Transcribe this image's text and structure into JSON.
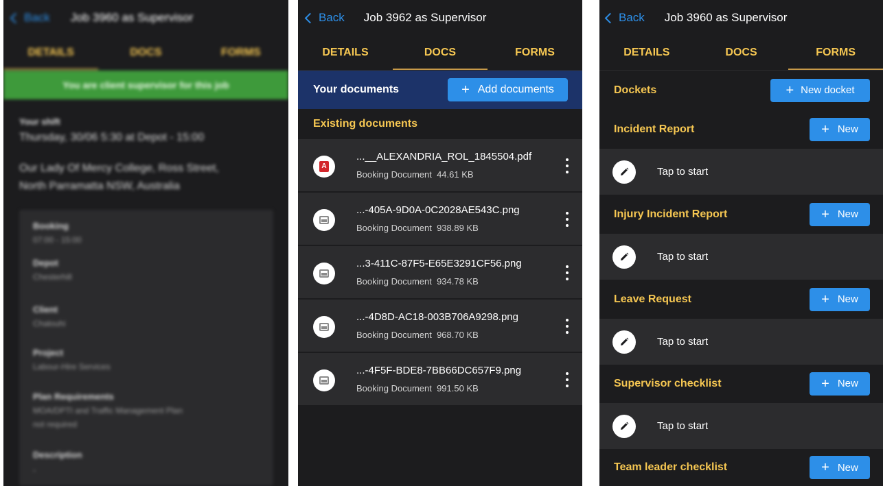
{
  "colors": {
    "accent": "#2d8fe8",
    "tab_text": "#f6c752",
    "banner_green": "#3e9a3b",
    "docs_header": "#1c3369",
    "background": "#1c1c1e",
    "row": "#2c2c2e"
  },
  "panel1": {
    "back_label": "Back",
    "title": "Job 3960 as Supervisor",
    "tabs": [
      "DETAILS",
      "DOCS",
      "FORMS"
    ],
    "active_tab": "DETAILS",
    "banner": "You are client supervisor for this job",
    "shift_label": "Your shift",
    "shift_value": "Thursday, 30/06 5:30 at Depot - 15:00",
    "address_line1": "Our Lady Of Mercy College, Ross Street,",
    "address_line2": "North Parramatta NSW, Australia",
    "card": [
      {
        "label": "Booking",
        "value": "07:00 - 15:00"
      },
      {
        "label": "Depot",
        "value": "Chesterhill"
      },
      {
        "label": "Client",
        "value": "Chalouhi"
      },
      {
        "label": "Project",
        "value": "Labour-Hire Services"
      },
      {
        "label": "Plan Requirements",
        "value": "MOA/DPTI and Traffic Management Plan",
        "value2": "not required"
      },
      {
        "label": "Description",
        "value": "-"
      }
    ]
  },
  "panel2": {
    "back_label": "Back",
    "title": "Job 3962 as Supervisor",
    "tabs": [
      "DETAILS",
      "DOCS",
      "FORMS"
    ],
    "active_tab": "DOCS",
    "your_documents": "Your documents",
    "add_button": "Add documents",
    "existing_label": "Existing documents",
    "documents": [
      {
        "icon": "pdf-icon",
        "name": "...__ALEXANDRIA_ROL_1845504.pdf",
        "type": "Booking Document",
        "size": "44.61 KB"
      },
      {
        "icon": "image-icon",
        "name": "...-405A-9D0A-0C2028AE543C.png",
        "type": "Booking Document",
        "size": "938.89 KB"
      },
      {
        "icon": "image-icon",
        "name": "...3-411C-87F5-E65E3291CF56.png",
        "type": "Booking Document",
        "size": "934.78 KB"
      },
      {
        "icon": "image-icon",
        "name": "...-4D8D-AC18-003B706A9298.png",
        "type": "Booking Document",
        "size": "968.70 KB"
      },
      {
        "icon": "image-icon",
        "name": "...-4F5F-BDE8-7BB66DC657F9.png",
        "type": "Booking Document",
        "size": "991.50 KB"
      }
    ]
  },
  "panel3": {
    "back_label": "Back",
    "title": "Job 3960 as Supervisor",
    "tabs": [
      "DETAILS",
      "DOCS",
      "FORMS"
    ],
    "active_tab": "FORMS",
    "dockets_label": "Dockets",
    "new_docket_button": "New docket",
    "new_button": "New",
    "tap_to_start": "Tap to start",
    "forms": [
      "Incident Report",
      "Injury Incident Report",
      "Leave Request",
      "Supervisor checklist",
      "Team leader checklist"
    ]
  }
}
